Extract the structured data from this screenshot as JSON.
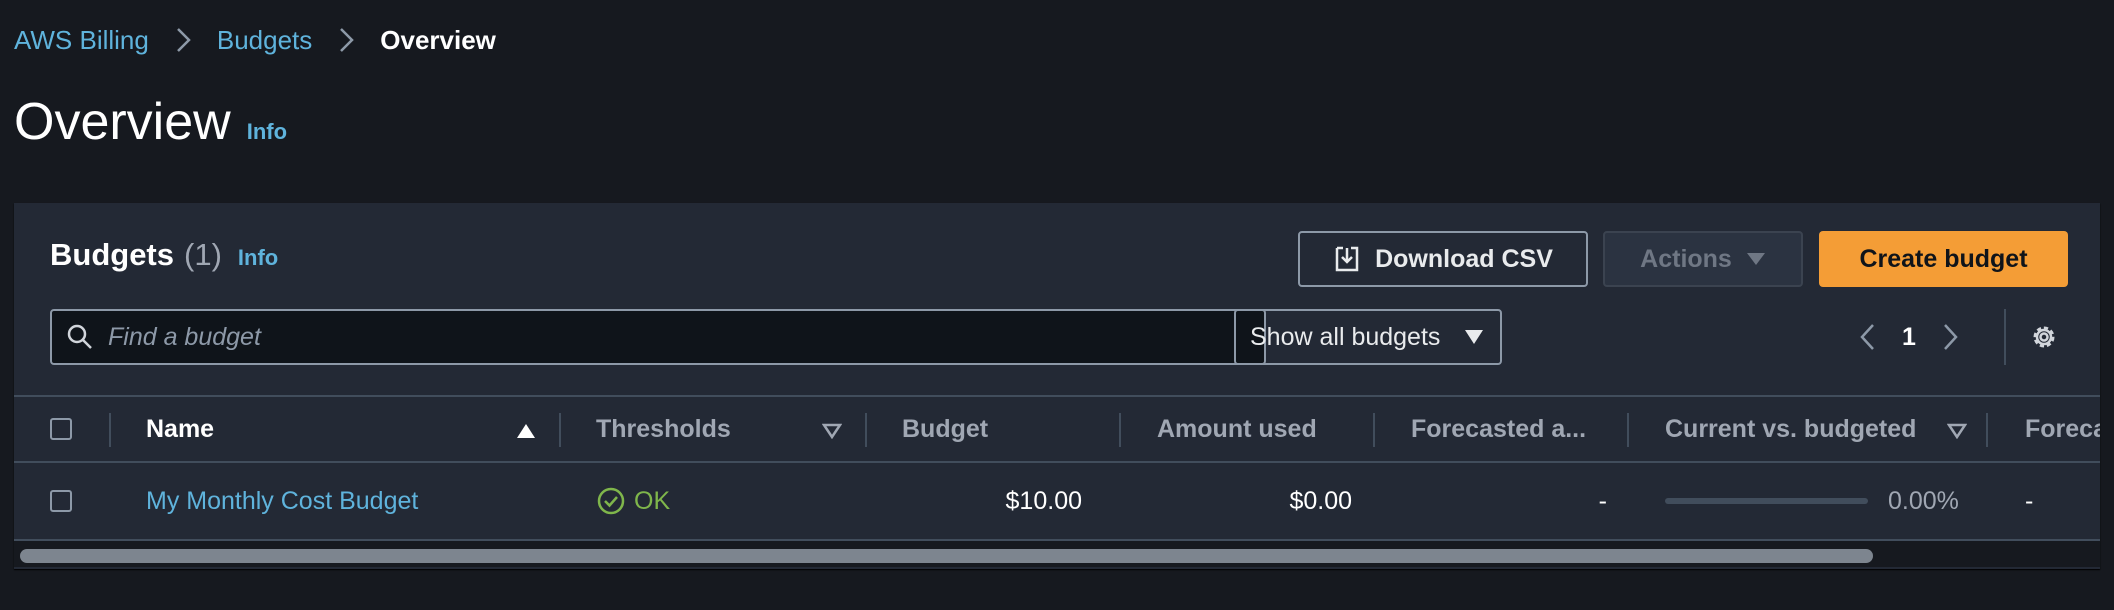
{
  "breadcrumbs": {
    "billing": "AWS Billing",
    "budgets": "Budgets",
    "current": "Overview"
  },
  "page": {
    "title": "Overview",
    "info": "Info"
  },
  "panel": {
    "title": "Budgets",
    "count": "(1)",
    "info": "Info",
    "download_csv": "Download CSV",
    "actions": "Actions",
    "create_budget": "Create budget",
    "search_placeholder": "Find a budget",
    "filter_selected": "Show all budgets",
    "page_number": "1"
  },
  "table": {
    "columns": {
      "name": "Name",
      "thresholds": "Thresholds",
      "budget": "Budget",
      "amount_used": "Amount used",
      "forecasted": "Forecasted a...",
      "current_vs_budgeted": "Current vs. budgeted",
      "forecast_cut": "Foreca"
    },
    "rows": [
      {
        "name": "My Monthly Cost Budget",
        "threshold_status": "OK",
        "budget": "$10.00",
        "amount_used": "$0.00",
        "forecasted": "-",
        "current_pct": "0.00%",
        "current_fraction": 0,
        "forecast_cut": "-"
      }
    ]
  },
  "colors": {
    "background": "#16191f",
    "panel": "#232935",
    "link": "#5fb3dc",
    "primary_button": "#f49d36",
    "ok_status": "#7fb64b"
  },
  "icons": [
    "chevron-right-icon",
    "download-icon",
    "caret-down-icon",
    "search-icon",
    "chevron-left-icon",
    "gear-icon",
    "sort-ascending-icon",
    "sort-descending-icon",
    "check-circle-icon"
  ]
}
